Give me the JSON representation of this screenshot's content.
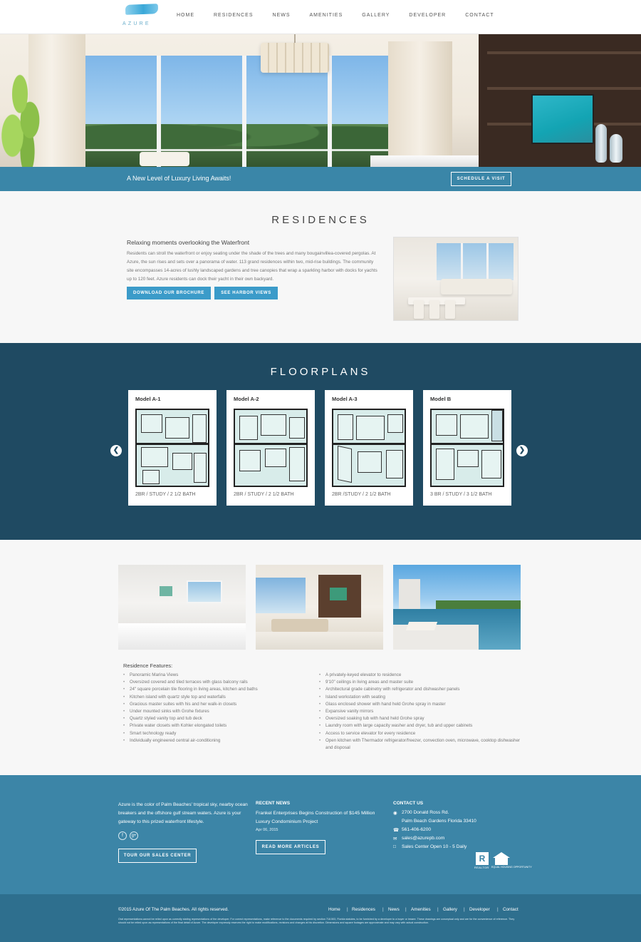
{
  "logo": {
    "text": "AZURE"
  },
  "nav": [
    "HOME",
    "RESIDENCES",
    "NEWS",
    "AMENITIES",
    "GALLERY",
    "DEVELOPER",
    "CONTACT"
  ],
  "banner": {
    "tagline": "A New Level of Luxury Living Awaits!",
    "cta": "SCHEDULE A VISIT"
  },
  "residences": {
    "title": "RESIDENCES",
    "subtitle": "Relaxing moments overlooking the Waterfront",
    "body": "Residents can stroll the waterfront or enjoy seating under the shade of the trees and many bougainvillea-covered pergolas. At Azure, the sun rises and sets over a panorama of water. 113 grand residences within two, mid-rise buildings. The community site encompasses 14-acres of lushly landscaped gardens and tree canopies that wrap a sparkling harbor with docks for yachts up to 120 feet. Azure residents can dock their yacht in their own backyard.",
    "btn_brochure": "DOWNLOAD OUR BROCHURE",
    "btn_harbor": "SEE HARBOR VIEWS"
  },
  "floorplans": {
    "title": "FLOORPLANS",
    "cards": [
      {
        "model": "Model A-1",
        "caption": "2BR / STUDY / 2 1/2 BATH"
      },
      {
        "model": "Model A-2",
        "caption": "2BR / STUDY / 2 1/2 BATH"
      },
      {
        "model": "Model A-3",
        "caption": "2BR /STUDY / 2 1/2 BATH"
      },
      {
        "model": "Model B",
        "caption": "3 BR / STUDY / 3 1/2 BATH"
      }
    ],
    "prev_icon": "chevron-left-icon",
    "next_icon": "chevron-right-icon"
  },
  "features": {
    "title": "Residence Features:",
    "left": [
      "Panoramic Marina Views",
      "Oversized covered and tiled terraces with glass balcony rails",
      "24\" square porcelain tile flooring in living areas, kitchen and baths",
      "Kitchen island with quartz style top and waterfalls",
      "Gracious master suites with his and her walk-in closets",
      "Under mounted sinks with Grohe fixtures",
      "Quartz styled vanity top and tub deck",
      "Private water closets with Kohler elongated toilets",
      "Smart technology ready",
      "Individually engineered central air-conditioning"
    ],
    "right": [
      "A privately-keyed elevator to residence",
      "9'10\" ceilings in living areas and master suite",
      "Architectural grade cabinetry with refrigerator and dishwasher panels",
      "Island workstation with seating",
      "Glass enclosed shower with hand held Grohe spray in master",
      "Expansive vanity mirrors",
      "Oversized soaking tub with hand held Grohe spray",
      "Laundry room with large capacity washer and dryer, tub and upper cabinets",
      "Access to service elevator for every residence",
      "Open kitchen with Thermador refrigerator/freezer, convection oven, microwave, cooktop dishwasher and disposal"
    ]
  },
  "footer": {
    "about": "Azure is the color of Palm Beaches' tropical sky, nearby ocean breakers and the offshore gulf stream waters. Azure is your gateway to this prized waterfront lifestyle.",
    "social": [
      {
        "icon": "facebook-icon",
        "glyph": "f"
      },
      {
        "icon": "google-plus-icon",
        "glyph": "g+"
      }
    ],
    "tour_btn": "TOUR OUR SALES CENTER",
    "news_heading": "RECENT NEWS",
    "news_title": "Frankel Enterprises Begins Construction of $145 Million Luxury Condominium Project",
    "news_date": "Apr 06, 2015",
    "news_btn": "READ MORE ARTICLES",
    "contact_heading": "CONTACT US",
    "address1": "2700 Donald Ross Rd.",
    "address2": "Palm Beach Gardens Florida 33410",
    "phone": "561-406-6200",
    "email": "sales@azurepb.com",
    "hours": "Sales Center Open 10 - 5 Daily",
    "realtor_mark": "R",
    "realtor_label": "REALTOR",
    "eho_label": "EQUAL HOUSING OPPORTUNITY"
  },
  "bottom": {
    "copyright": "©2015 Azure Of The Palm Beaches. All rights reserved.",
    "links": [
      "Home",
      "Residences",
      "News",
      "Amenities",
      "Gallery",
      "Developer",
      "Contact"
    ],
    "separator": "|",
    "disclaimer": "Oral representations cannot be relied upon as correctly stating representations of the developer. For correct representations, make reference to the documents required by section 718.503, Florida statutes, to be furnished by a developer to a buyer or lessee. These drawings are conceptual only and are for the convenience of reference. They should not be relied upon as representations of the final detail of Azure. The developer expressly reserves the right to make modifications, revisions and changes at his discretion. Dimensions and square footages are approximate and may vary with actual construction."
  },
  "colors": {
    "banner": "#3a86a8",
    "floorplans_bg": "#1f4a62",
    "footer_bg": "#3c85a7",
    "bottom_bg": "#2e6f8e",
    "button_blue": "#3b9bc9"
  }
}
